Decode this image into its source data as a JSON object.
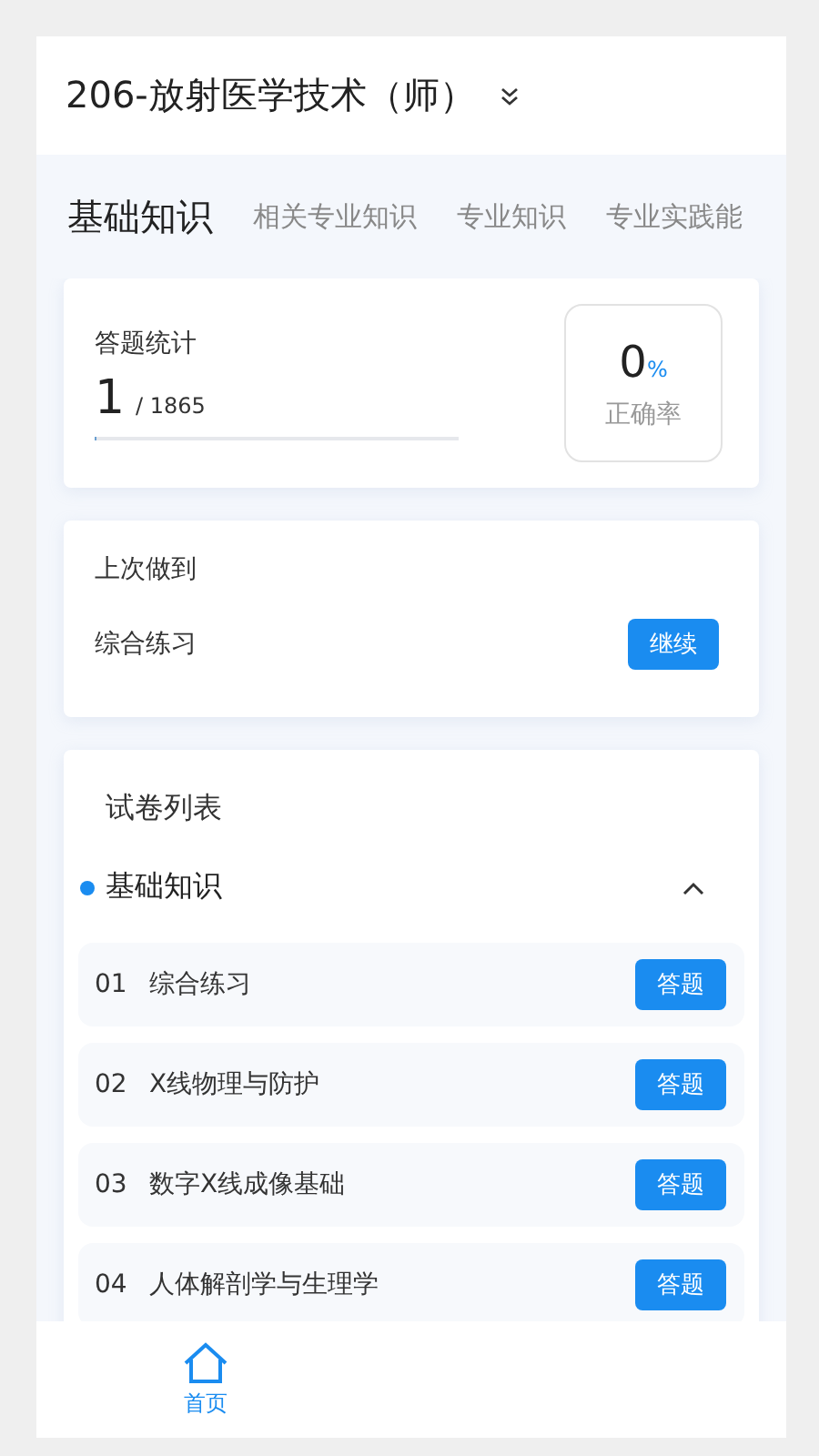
{
  "header": {
    "title": "206-放射医学技术（师）"
  },
  "tabs": [
    {
      "label": "基础知识",
      "selected": true
    },
    {
      "label": "相关专业知识",
      "selected": false
    },
    {
      "label": "专业知识",
      "selected": false
    },
    {
      "label": "专业实践能",
      "selected": false
    }
  ],
  "stats": {
    "title": "答题统计",
    "answered": "1",
    "total": "/ 1865",
    "level": 0.002,
    "rate": "0",
    "rate_unit": "%",
    "rate_label": "正确率"
  },
  "last": {
    "title": "上次做到",
    "item": "综合练习",
    "button": "继续"
  },
  "papers": {
    "title": "试卷列表",
    "section": {
      "label": "基础知识",
      "expanded": true,
      "color": "#1a8cf0"
    },
    "rows": [
      {
        "number": "01",
        "name": "综合练习",
        "button": "答题"
      },
      {
        "number": "02",
        "name": "X线物理与防护",
        "button": "答题"
      },
      {
        "number": "03",
        "name": "数字X线成像基础",
        "button": "答题"
      },
      {
        "number": "04",
        "name": "人体解剖学与生理学",
        "button": "答题"
      }
    ]
  },
  "nav": [
    {
      "label": "首页",
      "selected": true
    }
  ]
}
